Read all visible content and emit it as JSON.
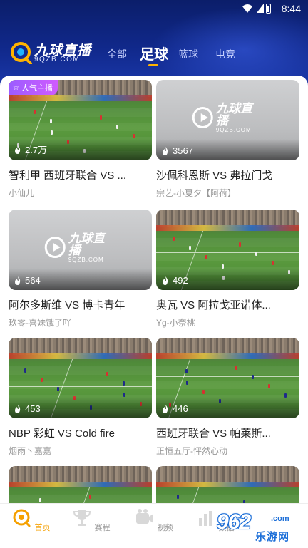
{
  "status_bar": {
    "time": "8:44"
  },
  "header": {
    "logo_text": "九球直播",
    "logo_sub": "9QZB.COM",
    "tabs": [
      {
        "label": "全部",
        "active": false
      },
      {
        "label": "足球",
        "active": true
      },
      {
        "label": "篮球",
        "active": false
      },
      {
        "label": "电竞",
        "active": false
      }
    ]
  },
  "placeholder": {
    "text": "九球直播",
    "sub": "9QZB.COM"
  },
  "cards": [
    {
      "title": "智利甲 西班牙联合 VS ...",
      "streamer": "小仙儿",
      "viewers": "2.7万",
      "badge": "人气主播",
      "thumb": "field"
    },
    {
      "title": "沙佩科恩斯 VS 弗拉门戈",
      "streamer": "宗艺-小夏夕【阿荷】",
      "viewers": "3567",
      "thumb": "placeholder"
    },
    {
      "title": "阿尔多斯维 VS 博卡青年",
      "streamer": "玖零-喜妹饿了吖",
      "viewers": "564",
      "thumb": "placeholder"
    },
    {
      "title": "奥瓦 VS 阿拉戈亚诺体...",
      "streamer": "Yg-小奈桃",
      "viewers": "492",
      "thumb": "field"
    },
    {
      "title": "NBP 彩虹 VS Cold fire",
      "streamer": "烟雨丶嘉嘉",
      "viewers": "453",
      "thumb": "field"
    },
    {
      "title": "西班牙联合 VS 帕莱斯...",
      "streamer": "正恒五厅-怦然心动",
      "viewers": "446",
      "thumb": "field"
    },
    {
      "title": "",
      "streamer": "",
      "viewers": "",
      "thumb": "field"
    },
    {
      "title": "",
      "streamer": "",
      "viewers": "",
      "thumb": "field"
    }
  ],
  "bottom_nav": [
    {
      "label": "首页",
      "active": true
    },
    {
      "label": "赛程",
      "active": false
    },
    {
      "label": "视频",
      "active": false
    },
    {
      "label": "数据",
      "active": false
    }
  ],
  "watermark": {
    "num": "962",
    "com": ".com",
    "cn": "乐游网"
  },
  "colors": {
    "accent": "#ffb300",
    "header": "#10288a",
    "nav_active": "#f5a000"
  }
}
